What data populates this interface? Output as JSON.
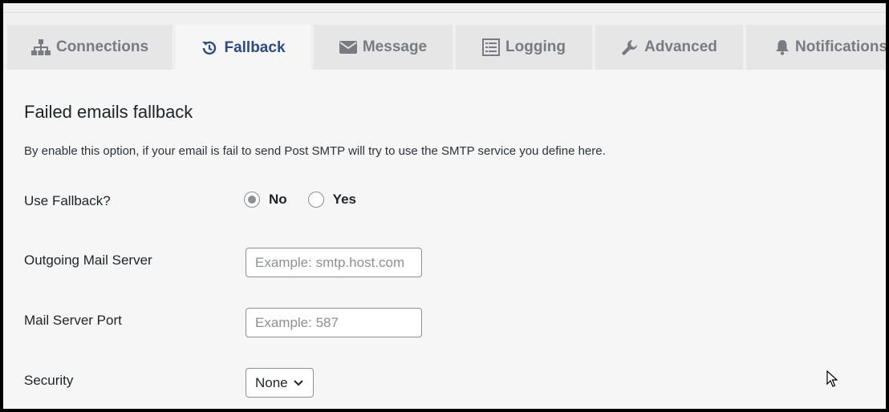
{
  "tabs": [
    {
      "label": "Connections",
      "icon": "sitemap-icon",
      "active": false
    },
    {
      "label": "Fallback",
      "icon": "history-icon",
      "active": true
    },
    {
      "label": "Message",
      "icon": "envelope-icon",
      "active": false
    },
    {
      "label": "Logging",
      "icon": "list-icon",
      "active": false
    },
    {
      "label": "Advanced",
      "icon": "wrench-icon",
      "active": false
    },
    {
      "label": "Notifications",
      "icon": "bell-icon",
      "active": false
    }
  ],
  "section": {
    "title": "Failed emails fallback",
    "description": "By enable this option, if your email is fail to send Post SMTP will try to use the SMTP service you define here."
  },
  "fields": {
    "use_fallback": {
      "label": "Use Fallback?",
      "options": [
        "No",
        "Yes"
      ],
      "selected": "No"
    },
    "outgoing_server": {
      "label": "Outgoing Mail Server",
      "placeholder": "Example: smtp.host.com",
      "value": ""
    },
    "server_port": {
      "label": "Mail Server Port",
      "placeholder": "Example: 587",
      "value": ""
    },
    "security": {
      "label": "Security",
      "selected": "None"
    }
  },
  "colors": {
    "active_tab_text": "#2c4a8a",
    "inactive_tab_text": "#787c82",
    "tab_background": "#e6e6e6",
    "content_background": "#f6f6f6"
  }
}
